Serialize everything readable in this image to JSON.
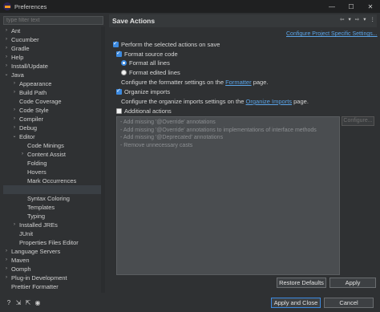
{
  "window": {
    "title": "Preferences",
    "minimize": "—",
    "maximize": "☐",
    "close": "✕"
  },
  "filter": {
    "placeholder": "type filter text"
  },
  "tree": [
    {
      "label": "Ant",
      "level": 0,
      "chev": "›"
    },
    {
      "label": "Cucumber",
      "level": 0,
      "chev": "›"
    },
    {
      "label": "Gradle",
      "level": 0,
      "chev": "›"
    },
    {
      "label": "Help",
      "level": 0,
      "chev": "›"
    },
    {
      "label": "Install/Update",
      "level": 0,
      "chev": "›"
    },
    {
      "label": "Java",
      "level": 0,
      "chev": "⌄"
    },
    {
      "label": "Appearance",
      "level": 1,
      "chev": "›"
    },
    {
      "label": "Build Path",
      "level": 1,
      "chev": "›"
    },
    {
      "label": "Code Coverage",
      "level": 1,
      "chev": ""
    },
    {
      "label": "Code Style",
      "level": 1,
      "chev": "›"
    },
    {
      "label": "Compiler",
      "level": 1,
      "chev": "›"
    },
    {
      "label": "Debug",
      "level": 1,
      "chev": "›"
    },
    {
      "label": "Editor",
      "level": 1,
      "chev": "⌄"
    },
    {
      "label": "Code Minings",
      "level": 2,
      "chev": ""
    },
    {
      "label": "Content Assist",
      "level": 2,
      "chev": "›"
    },
    {
      "label": "Folding",
      "level": 2,
      "chev": ""
    },
    {
      "label": "Hovers",
      "level": 2,
      "chev": ""
    },
    {
      "label": "Mark Occurrences",
      "level": 2,
      "chev": ""
    },
    {
      "label": "",
      "level": 2,
      "chev": "",
      "selected": true
    },
    {
      "label": "Syntax Coloring",
      "level": 2,
      "chev": ""
    },
    {
      "label": "Templates",
      "level": 2,
      "chev": ""
    },
    {
      "label": "Typing",
      "level": 2,
      "chev": ""
    },
    {
      "label": "Installed JREs",
      "level": 1,
      "chev": "›"
    },
    {
      "label": "JUnit",
      "level": 1,
      "chev": ""
    },
    {
      "label": "Properties Files Editor",
      "level": 1,
      "chev": ""
    },
    {
      "label": "Language Servers",
      "level": 0,
      "chev": "›"
    },
    {
      "label": "Maven",
      "level": 0,
      "chev": "›"
    },
    {
      "label": "Oomph",
      "level": 0,
      "chev": "›"
    },
    {
      "label": "Plug-in Development",
      "level": 0,
      "chev": "›"
    },
    {
      "label": "Prettier Formatter",
      "level": 0,
      "chev": ""
    }
  ],
  "header": {
    "title": "Save Actions",
    "back": "⇦",
    "back_menu": "▾",
    "forward": "⇨",
    "forward_menu": "▾",
    "menu": "⋮"
  },
  "configure_link": "Configure Project Specific Settings...",
  "options": {
    "perform": "Perform the selected actions on save",
    "format_source": "Format source code",
    "format_all": "Format all lines",
    "format_edited": "Format edited lines",
    "formatter_prefix": "Configure the formatter settings on the",
    "formatter_link": "Formatter",
    "formatter_suffix": "page.",
    "organize": "Organize imports",
    "organize_prefix": "Configure the organize imports settings on the",
    "organize_link": "Organize Imports",
    "organize_suffix": "page.",
    "additional": "Additional actions"
  },
  "additional_actions": [
    "- Add missing '@Override' annotations",
    "- Add missing '@Override' annotations to implementations of interface methods",
    "- Add missing '@Deprecated' annotations",
    "- Remove unnecessary casts"
  ],
  "buttons": {
    "configure": "Configure...",
    "restore": "Restore Defaults",
    "apply": "Apply",
    "apply_close": "Apply and Close",
    "cancel": "Cancel"
  },
  "footer_icons": [
    "help-icon",
    "import-icon",
    "export-icon",
    "preferences-icon"
  ]
}
